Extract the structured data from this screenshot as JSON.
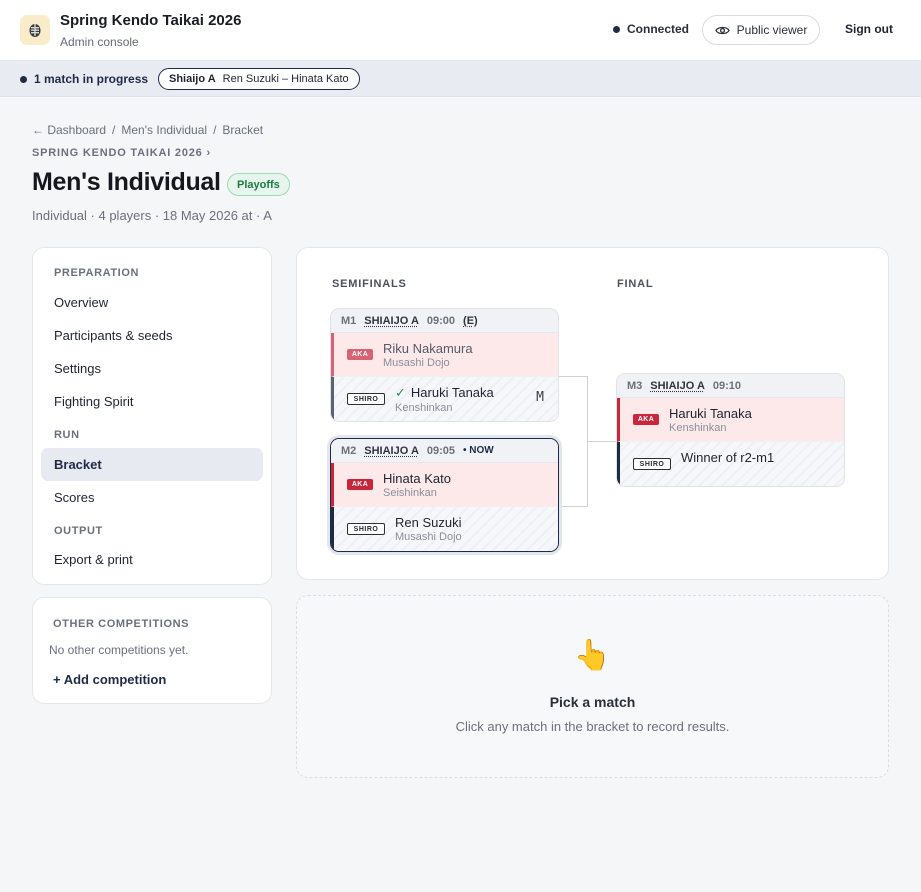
{
  "app": {
    "title": "Spring Kendo Taikai 2026",
    "subtitle": "Admin console",
    "connection": "Connected",
    "public_viewer": "Public viewer",
    "sign_out": "Sign out"
  },
  "status": {
    "progress": "1 match in progress",
    "live_court": "Shiaijo A",
    "live_players": "Ren Suzuki – Hinata Kato"
  },
  "breadcrumb": {
    "back": "← Dashboard",
    "sep": "/",
    "section": "Men's Individual",
    "current": "Bracket"
  },
  "page": {
    "eyebrow": "SPRING KENDO TAIKAI 2026 ›",
    "title": "Men's Individual",
    "phase": "Playoffs",
    "meta": "Individual · 4 players · 18 May 2026 at · A"
  },
  "sidebar": {
    "sections": {
      "preparation": "PREPARATION",
      "run": "RUN",
      "output": "OUTPUT"
    },
    "items": {
      "overview": "Overview",
      "participants": "Participants & seeds",
      "settings": "Settings",
      "fighting_spirit": "Fighting Spirit",
      "bracket": "Bracket",
      "scores": "Scores",
      "export": "Export & print"
    }
  },
  "other_competitions": {
    "title": "OTHER COMPETITIONS",
    "empty": "No other competitions yet.",
    "add": "+ Add competition"
  },
  "bracket": {
    "rounds": [
      "SEMIFINALS",
      "FINAL"
    ],
    "tags": {
      "aka": "AKA",
      "shiro": "SHIRO"
    },
    "matches": [
      {
        "id": "M1",
        "court": "SHIAIJO A",
        "time": "09:00",
        "extra": "(E)",
        "aka": {
          "name": "Riku Nakamura",
          "dojo": "Musashi Dojo"
        },
        "shiro": {
          "name": "Haruki Tanaka",
          "dojo": "Kenshinkan",
          "mark": "✓",
          "score": "M"
        }
      },
      {
        "id": "M2",
        "court": "SHIAIJO A",
        "time": "09:05",
        "extra": "• NOW",
        "aka": {
          "name": "Hinata Kato",
          "dojo": "Seishinkan"
        },
        "shiro": {
          "name": "Ren Suzuki",
          "dojo": "Musashi Dojo"
        }
      },
      {
        "id": "M3",
        "court": "SHIAIJO A",
        "time": "09:10",
        "aka": {
          "name": "Haruki Tanaka",
          "dojo": "Kenshinkan"
        },
        "shiro": {
          "name": "Winner of r2-m1"
        }
      }
    ]
  },
  "detail": {
    "icon": "👆",
    "title": "Pick a match",
    "subtitle": "Click any match in the bracket to record results."
  },
  "colors": {
    "aka": "#c8263a",
    "shiro": "#1f2a44",
    "accent": "#1f2a44",
    "success": "#1d7a45"
  }
}
